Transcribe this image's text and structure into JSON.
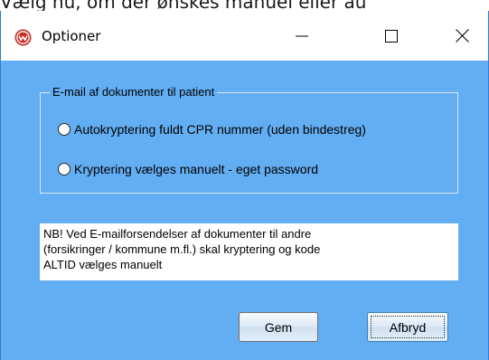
{
  "background_text": "Vælg nu, om der ønskes manuel  eller au",
  "window": {
    "title": "Optioner",
    "controls": {
      "minimize": "—",
      "maximize": "☐",
      "close": "✕"
    }
  },
  "group": {
    "legend": "E-mail af dokumenter til patient",
    "options": [
      {
        "label": "Autokryptering fuldt CPR nummer (uden bindestreg)",
        "checked": false
      },
      {
        "label": "Kryptering vælges manuelt - eget password",
        "checked": false
      }
    ]
  },
  "notice": {
    "lines": [
      "NB!  Ved E-mailforsendelser af dokumenter til andre",
      "(forsikringer / kommune m.fl.) skal kryptering og kode",
      "ALTID vælges manuelt"
    ]
  },
  "buttons": {
    "save": "Gem",
    "cancel": "Afbryd"
  },
  "colors": {
    "client_bg": "#63adf2",
    "window_border": "#2a7fd0",
    "app_icon": "#c8322a"
  },
  "icons": {
    "app": "app-logo-icon",
    "minimize": "minimize-icon",
    "maximize": "maximize-icon",
    "close": "close-icon"
  }
}
